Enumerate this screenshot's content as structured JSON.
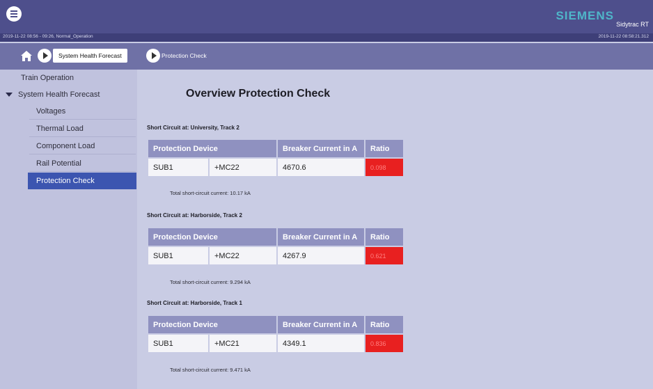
{
  "header": {
    "status_left": "2019-11-22 08:56 - 09:26, Normal_Operation",
    "status_right": "2019-11-22 08:58:21.312",
    "logo": "SIEMENS",
    "app_name": "Sidytrac RT"
  },
  "breadcrumb": {
    "parent": "System Health Forecast",
    "current": "Protection Check"
  },
  "sidebar": {
    "items": [
      {
        "label": "Train Operation"
      },
      {
        "label": "System Health Forecast"
      },
      {
        "label": "Voltages"
      },
      {
        "label": "Thermal Load"
      },
      {
        "label": "Component Load"
      },
      {
        "label": "Rail Potential"
      },
      {
        "label": "Protection Check"
      }
    ]
  },
  "main": {
    "title": "Overview Protection Check",
    "columns": [
      "Protection Device",
      "Breaker Current in A",
      "Ratio"
    ],
    "sections": [
      {
        "title": "Short Circuit at: University, Track 2",
        "device": "SUB1",
        "breaker": "+MC22",
        "current": "4670.6",
        "ratio": "0.098",
        "total": "Total short-circuit current: 10.17 kA"
      },
      {
        "title": "Short Circuit at: Harborside, Track 2",
        "device": "SUB1",
        "breaker": "+MC22",
        "current": "4267.9",
        "ratio": "0.621",
        "total": "Total short-circuit current: 9.294 kA"
      },
      {
        "title": "Short Circuit at: Harborside, Track 1",
        "device": "SUB1",
        "breaker": "+MC21",
        "current": "4349.1",
        "ratio": "0.836",
        "total": "Total short-circuit current: 9.471 kA"
      }
    ]
  },
  "colors": {
    "header_bg": "#4e4f8c",
    "nav_bg": "#6f71a6",
    "sidebar_active": "#3c55b0",
    "table_header": "#8f91c0",
    "ratio_alarm": "#e82020",
    "logo": "#4fb6c9"
  },
  "icons": [
    "menu-icon",
    "home-icon",
    "chevron-right-icon",
    "triangle-down-icon"
  ]
}
